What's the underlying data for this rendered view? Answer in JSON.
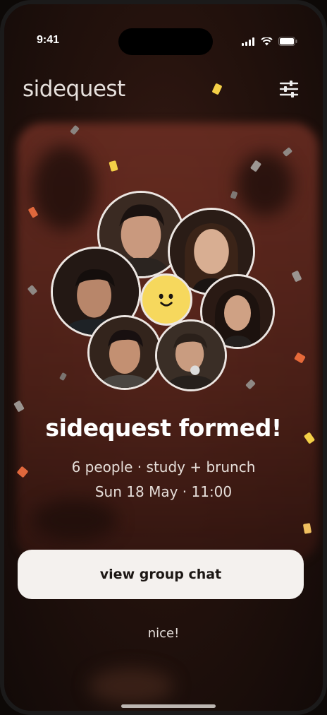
{
  "status_bar": {
    "time": "9:41",
    "icons": [
      "signal-icon",
      "wifi-icon",
      "battery-icon"
    ]
  },
  "header": {
    "brand": "sidequest",
    "filter_icon": "sliders-icon"
  },
  "avatars": {
    "members": [
      "member-1",
      "member-2",
      "member-3",
      "member-4",
      "member-5",
      "member-6"
    ],
    "center_icon": "smiley-icon"
  },
  "main": {
    "headline": "sidequest formed!",
    "details": "6 people · study + brunch",
    "schedule": "Sun 18 May · 11:00"
  },
  "actions": {
    "primary_label": "view group chat",
    "secondary_label": "nice!"
  },
  "colors": {
    "background": "#24120d",
    "accent_yellow": "#f6d85d",
    "button_bg": "#f4f1ee",
    "text_primary": "#ffffff"
  }
}
